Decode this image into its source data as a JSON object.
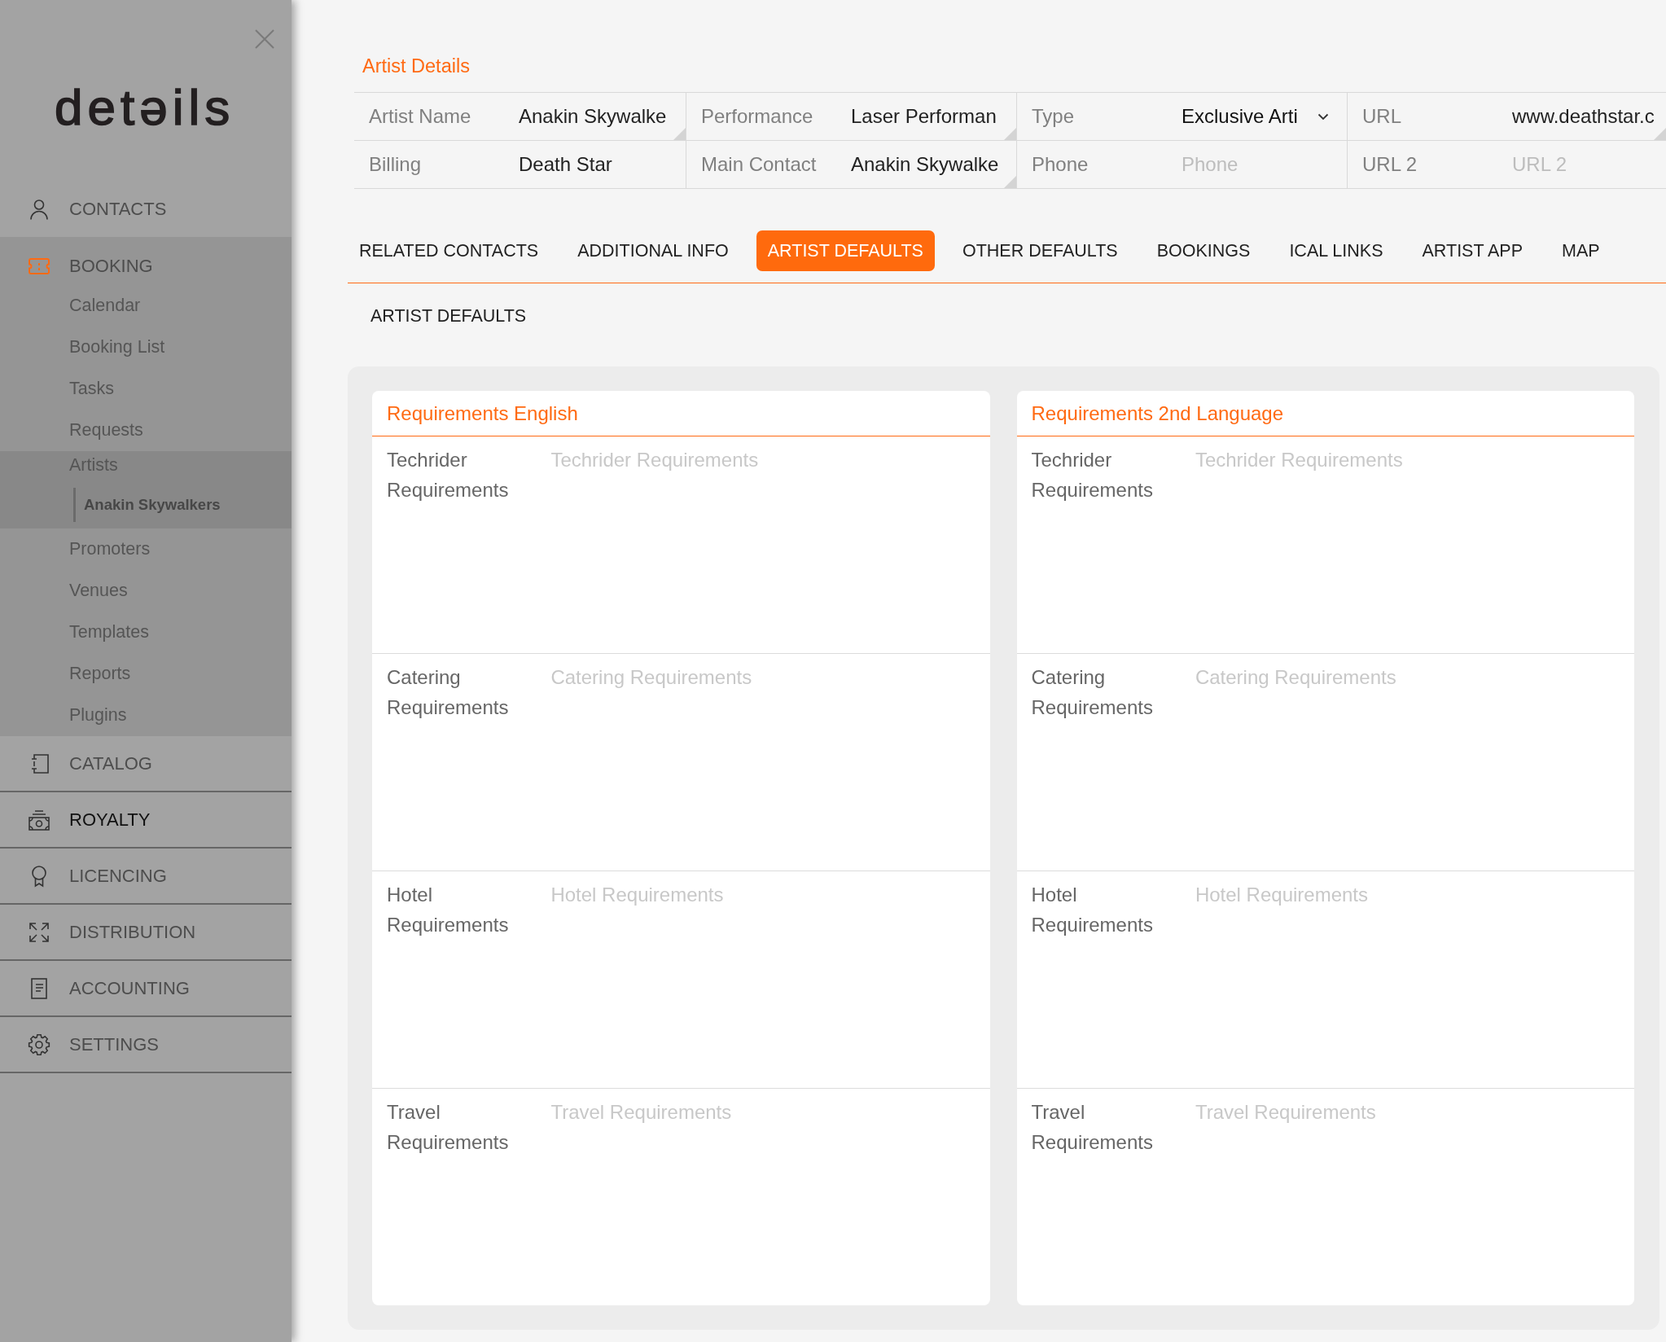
{
  "sidebar": {
    "logo": "detəils",
    "nav": [
      {
        "label": "CONTACTS",
        "selected": false,
        "expanded": false,
        "hovered": false
      },
      {
        "label": "BOOKING",
        "selected": true,
        "expanded": true,
        "hovered": false,
        "children": [
          {
            "label": "Calendar",
            "selected": false
          },
          {
            "label": "Booking List",
            "selected": false
          },
          {
            "label": "Tasks",
            "selected": false
          },
          {
            "label": "Requests",
            "selected": false
          },
          {
            "label": "Artists",
            "selected": true,
            "children": [
              {
                "label": "Anakin Skywalkers",
                "selected": true
              }
            ]
          },
          {
            "label": "Promoters",
            "selected": false
          },
          {
            "label": "Venues",
            "selected": false
          },
          {
            "label": "Templates",
            "selected": false
          },
          {
            "label": "Reports",
            "selected": false
          },
          {
            "label": "Plugins",
            "selected": false
          }
        ]
      },
      {
        "label": "CATALOG",
        "selected": false,
        "expanded": false,
        "hovered": false
      },
      {
        "label": "ROYALTY",
        "selected": false,
        "expanded": false,
        "hovered": true
      },
      {
        "label": "LICENCING",
        "selected": false,
        "expanded": false,
        "hovered": false
      },
      {
        "label": "DISTRIBUTION",
        "selected": false,
        "expanded": false,
        "hovered": false
      },
      {
        "label": "ACCOUNTING",
        "selected": false,
        "expanded": false,
        "hovered": false
      },
      {
        "label": "SETTINGS",
        "selected": false,
        "expanded": false,
        "hovered": false
      }
    ]
  },
  "details": {
    "title": "Artist Details",
    "fields": [
      {
        "label": "Artist Name",
        "value": "Anakin Skywalke",
        "kind": "textarea"
      },
      {
        "label": "Performance",
        "value": "Laser Performan",
        "kind": "textarea"
      },
      {
        "label": "Type",
        "value": "Exclusive Arti",
        "kind": "select"
      },
      {
        "label": "URL",
        "value": "www.deathstar.c",
        "kind": "textarea"
      },
      {
        "label": "Billing",
        "value": "Death Star",
        "kind": "text"
      },
      {
        "label": "Main Contact",
        "value": "Anakin Skywalke",
        "kind": "textarea"
      },
      {
        "label": "Phone",
        "placeholder": "Phone",
        "kind": "text"
      },
      {
        "label": "URL 2",
        "placeholder": "URL 2",
        "kind": "text"
      }
    ]
  },
  "tabs": [
    {
      "label": "RELATED CONTACTS",
      "selected": false
    },
    {
      "label": "ADDITIONAL INFO",
      "selected": false
    },
    {
      "label": "ARTIST DEFAULTS",
      "selected": true
    },
    {
      "label": "OTHER DEFAULTS",
      "selected": false
    },
    {
      "label": "BOOKINGS",
      "selected": false
    },
    {
      "label": "ICAL LINKS",
      "selected": false
    },
    {
      "label": "ARTIST APP",
      "selected": false
    },
    {
      "label": "MAP",
      "selected": false
    }
  ],
  "section_title": "ARTIST DEFAULTS",
  "cards": [
    {
      "title": "Requirements English",
      "rows": [
        {
          "label": "Techrider Requirements",
          "placeholder": "Techrider Requirements"
        },
        {
          "label": "Catering Requirements",
          "placeholder": "Catering Requirements"
        },
        {
          "label": "Hotel Requirements",
          "placeholder": "Hotel Requirements"
        },
        {
          "label": "Travel Requirements",
          "placeholder": "Travel Requirements"
        }
      ]
    },
    {
      "title": "Requirements 2nd Language",
      "rows": [
        {
          "label": "Techrider Requirements",
          "placeholder": "Techrider Requirements"
        },
        {
          "label": "Catering Requirements",
          "placeholder": "Catering Requirements"
        },
        {
          "label": "Hotel Requirements",
          "placeholder": "Hotel Requirements"
        },
        {
          "label": "Travel Requirements",
          "placeholder": "Travel Requirements"
        }
      ]
    }
  ]
}
